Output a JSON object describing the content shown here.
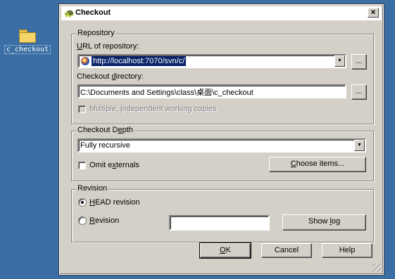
{
  "desktop": {
    "icon_label": "c_checkout"
  },
  "dialog": {
    "title": "Checkout",
    "close_glyph": "×",
    "repository": {
      "legend": "Repository",
      "url_label_pre": "",
      "url_label_key": "U",
      "url_label_post": "RL of repository:",
      "url_value": "http://localhost:7070/svn/c/",
      "browse_label": "...",
      "dir_label_pre": "Checkout ",
      "dir_label_key": "d",
      "dir_label_post": "irectory:",
      "dir_value": "C:\\Documents and Settings\\class\\桌面\\c_checkout",
      "browse2_label": "...",
      "multiple_label_pre": "Multiple, ",
      "multiple_label_key": "i",
      "multiple_label_post": "ndependent working copies"
    },
    "depth": {
      "legend_pre": "Checkout D",
      "legend_key": "e",
      "legend_post": "pth",
      "selected": "Fully recursive",
      "omit_pre": "Omit e",
      "omit_key": "x",
      "omit_post": "ternals",
      "choose_pre": "",
      "choose_key": "C",
      "choose_post": "hoose items..."
    },
    "revision": {
      "legend": "Revision",
      "head_pre": "",
      "head_key": "H",
      "head_post": "EAD revision",
      "rev_pre": "",
      "rev_key": "R",
      "rev_post": "evision",
      "rev_value": "",
      "showlog_pre": "Show ",
      "showlog_key": "l",
      "showlog_post": "og"
    },
    "buttons": {
      "ok_key": "O",
      "ok_post": "K",
      "cancel": "Cancel",
      "help": "Help"
    }
  }
}
